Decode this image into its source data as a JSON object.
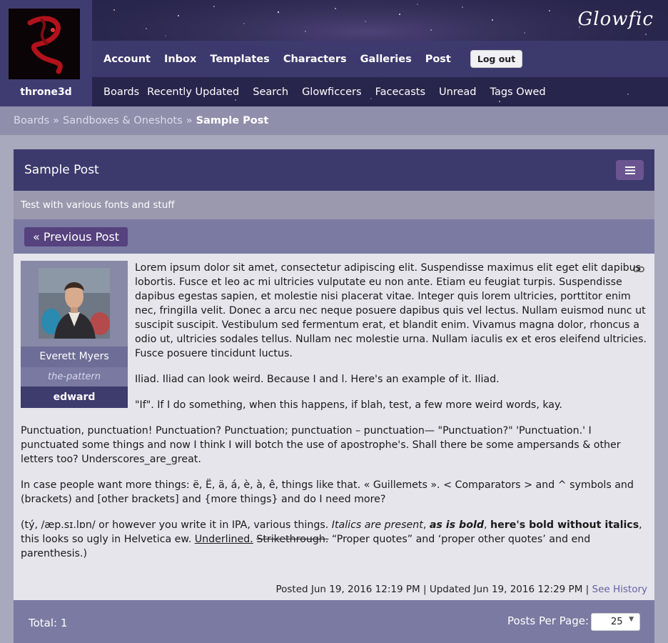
{
  "app": {
    "logo": "Glowfic",
    "username": "throne3d"
  },
  "nav": {
    "main": [
      "Account",
      "Inbox",
      "Templates",
      "Characters",
      "Galleries",
      "Post"
    ],
    "logout": "Log out",
    "sub": [
      "Boards",
      "Recently Updated",
      "Search",
      "Glowficcers",
      "Facecasts",
      "Unread",
      "Tags Owed"
    ]
  },
  "breadcrumb": {
    "board": "Boards",
    "section": "Sandboxes & Oneshots",
    "sep": "»",
    "current": "Sample Post"
  },
  "post": {
    "title": "Sample Post",
    "description": "Test with various fonts and stuff",
    "prev_label": "« Previous Post",
    "character": {
      "name": "Everett Myers",
      "screenname": "the-pattern",
      "author": "edward"
    },
    "paragraphs": [
      "Lorem ipsum dolor sit amet, consectetur adipiscing elit. Suspendisse maximus elit eget elit dapibus lobortis. Fusce et leo ac mi ultricies vulputate eu non ante. Etiam eu feugiat turpis. Suspendisse dapibus egestas sapien, et molestie nisi placerat vitae. Integer quis lorem ultricies, porttitor enim nec, fringilla velit. Donec a arcu nec neque posuere dapibus quis vel lectus. Nullam euismod nunc ut suscipit suscipit. Vestibulum sed fermentum erat, et blandit enim. Vivamus magna dolor, rhoncus a odio ut, ultricies sodales tellus. Nullam nec molestie urna. Nullam iaculis ex et eros eleifend ultricies. Fusce posuere tincidunt luctus.",
      "Iliad. Iliad can look weird. Because I and l. Here's an example of it. Iliad.",
      "\"If\". If I do something, when this happens, if blah, test, a few more weird words, kay.",
      "Punctuation, punctuation! Punctuation? Punctuation; punctuation – punctuation— \"Punctuation?\" 'Punctuation.' I punctuated some things and now I think I will botch the use of apostrophe's. Shall there be some ampersands & other letters too? Underscores_are_great.",
      "In case people want more things: ë, Ë, ä, á, è, à, ê, things like that. « Guillemets ». < Comparators > and ^ symbols and (brackets) and [other brackets] and {more things} and do I need more?"
    ],
    "last_paragraph": {
      "start": "(tý, /æp.sɪ.lɒn/ or however you write it in IPA, various things. ",
      "italic": "Italics are present",
      "comma": ", ",
      "bold_italic": "as is bold",
      "comma2": ", ",
      "bold": "here's bold without italics",
      "mid": ", this looks so ugly in Helvetica ew. ",
      "underlined": "Underlined.",
      "space": " ",
      "strike": "Strikethrough.",
      "end": " “Proper quotes” and ‘proper other quotes’ and end parenthesis.)"
    },
    "footer": {
      "posted": "Posted Jun 19, 2016 12:19 PM",
      "sep": "|",
      "updated": "Updated Jun 19, 2016 12:29 PM",
      "history": "See History"
    }
  },
  "pagination": {
    "total": "Total: 1",
    "per_page_label": "Posts Per Page:",
    "per_page_value": "25"
  },
  "colors": {
    "header": "#3e3b70",
    "breadcrumb": "#8f8fab",
    "title_bar": "#3c3a6c",
    "accent_button": "#56427e"
  }
}
